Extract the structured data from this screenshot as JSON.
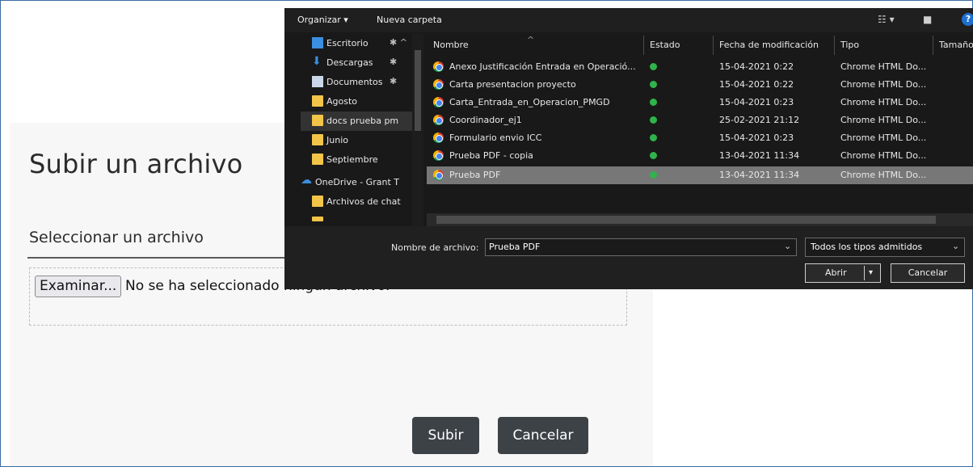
{
  "upload": {
    "title": "Subir un archivo",
    "select_label": "Seleccionar un archivo",
    "browse_label": "Examinar...",
    "file_status": "No se ha seleccionado ningún archivo.",
    "submit_label": "Subir",
    "cancel_label": "Cancelar"
  },
  "dialog": {
    "toolbar": {
      "organize": "Organizar ▾",
      "new_folder": "Nueva carpeta"
    },
    "nav_items": [
      {
        "label": "Escritorio",
        "pinned": true
      },
      {
        "label": "Descargas",
        "pinned": true
      },
      {
        "label": "Documentos",
        "pinned": true
      },
      {
        "label": "Agosto"
      },
      {
        "label": "docs prueba pm",
        "active": true
      },
      {
        "label": "Junio"
      },
      {
        "label": "Septiembre"
      },
      {
        "label": "OneDrive - Grant T"
      },
      {
        "label": "Archivos de chat"
      }
    ],
    "columns": {
      "name": "Nombre",
      "status": "Estado",
      "modified": "Fecha de modificación",
      "type": "Tipo",
      "size": "Tamaño"
    },
    "files": [
      {
        "name": "Anexo Justificación Entrada en Operació...",
        "modified": "15-04-2021 0:22",
        "type": "Chrome HTML Do..."
      },
      {
        "name": "Carta presentacion proyecto",
        "modified": "15-04-2021 0:22",
        "type": "Chrome HTML Do..."
      },
      {
        "name": "Carta_Entrada_en_Operacion_PMGD",
        "modified": "15-04-2021 0:23",
        "type": "Chrome HTML Do..."
      },
      {
        "name": "Coordinador_ej1",
        "modified": "25-02-2021 21:12",
        "type": "Chrome HTML Do..."
      },
      {
        "name": "Formulario envio ICC",
        "modified": "15-04-2021 0:23",
        "type": "Chrome HTML Do..."
      },
      {
        "name": "Prueba PDF - copia",
        "modified": "13-04-2021 11:34",
        "type": "Chrome HTML Do..."
      },
      {
        "name": "Prueba PDF",
        "modified": "13-04-2021 11:34",
        "type": "Chrome HTML Do...",
        "selected": true
      }
    ],
    "filename_label": "Nombre de archivo:",
    "filename_value": "Prueba PDF",
    "filetype_value": "Todos los tipos admitidos",
    "open_label": "Abrir",
    "cancel_label": "Cancelar",
    "colors": {
      "background": "#191919",
      "selected_row": "#777777",
      "status_ok": "#2fb34a",
      "help": "#1e6fd0"
    }
  }
}
